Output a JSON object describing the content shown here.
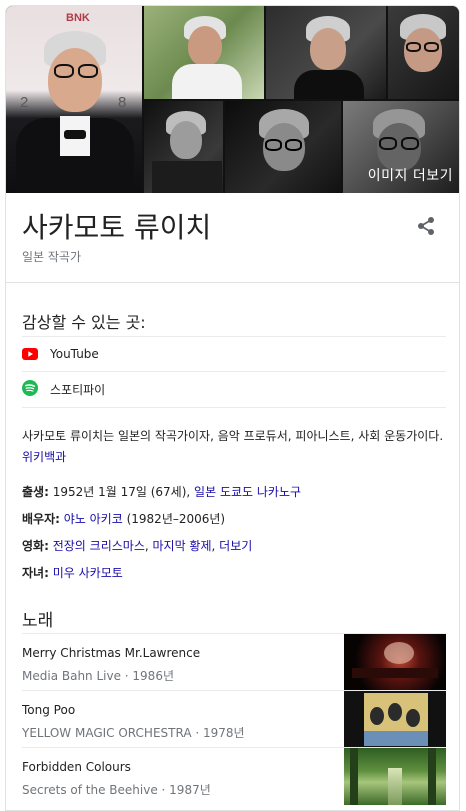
{
  "photos": {
    "more_images_label": "이미지 더보기",
    "backdrop_text_top": "BNK",
    "backdrop_text_year_1": "2",
    "backdrop_text_year_2": "8"
  },
  "header": {
    "title": "사카모토 류이치",
    "subtitle": "일본 작곡가"
  },
  "listen": {
    "title": "감상할 수 있는 곳:",
    "items": [
      {
        "label": "YouTube",
        "icon": "youtube-icon",
        "color": "#ff0000"
      },
      {
        "label": "스포티파이",
        "icon": "spotify-icon",
        "color": "#1db954"
      }
    ]
  },
  "description": {
    "text": "사카모토 류이치는 일본의 작곡가이자, 음악 프로듀서, 피아니스트, 사회 운동가이다.",
    "source_link": "위키백과"
  },
  "facts": {
    "born": {
      "label": "출생:",
      "text": "1952년 1월 17일 (67세),",
      "link": "일본 도쿄도 나카노구"
    },
    "spouse": {
      "label": "배우자:",
      "link": "야노 아키코",
      "text": "(1982년–2006년)"
    },
    "films": {
      "label": "영화:",
      "links": [
        "전장의 크리스마스",
        "마지막 황제",
        "더보기"
      ],
      "sep": ", "
    },
    "children": {
      "label": "자녀:",
      "link": "미우 사카모토"
    }
  },
  "songs": {
    "title": "노래",
    "items": [
      {
        "name": "Merry Christmas Mr.Lawrence",
        "meta": "Media Bahn Live · 1986년"
      },
      {
        "name": "Tong Poo",
        "meta": "YELLOW MAGIC ORCHESTRA · 1978년"
      },
      {
        "name": "Forbidden Colours",
        "meta": "Secrets of the Beehive · 1987년"
      }
    ]
  },
  "colors": {
    "link": "#1a0dab",
    "secondary_text": "#70757a",
    "divider": "#dfe1e5"
  }
}
